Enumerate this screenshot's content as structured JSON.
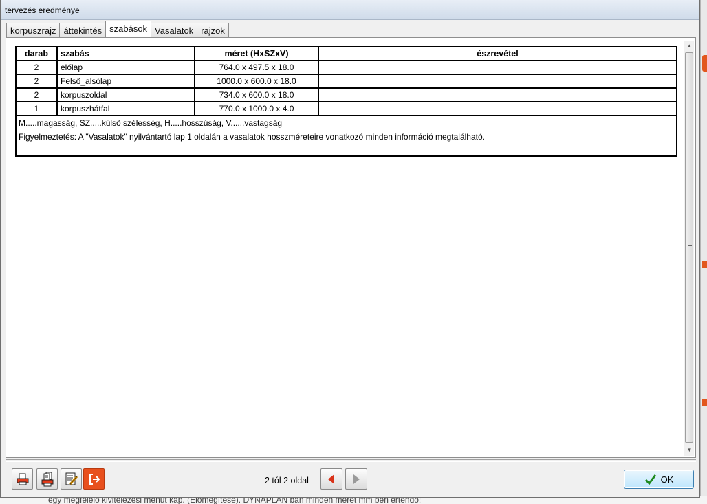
{
  "window": {
    "title": "tervezés eredménye"
  },
  "tabs": [
    {
      "label": "korpuszrajz",
      "active": false
    },
    {
      "label": "áttekintés",
      "active": false
    },
    {
      "label": "szabások",
      "active": true
    },
    {
      "label": "Vasalatok",
      "active": false
    },
    {
      "label": "rajzok",
      "active": false
    }
  ],
  "table": {
    "headers": {
      "qty": "darab",
      "name": "szabás",
      "size": "méret (HxSZxV)",
      "note": "észrevétel"
    },
    "rows": [
      {
        "qty": "2",
        "name": "előlap",
        "size": "764.0 x 497.5 x 18.0",
        "note": ""
      },
      {
        "qty": "2",
        "name": "Felső_alsólap",
        "size": "1000.0 x 600.0 x 18.0",
        "note": ""
      },
      {
        "qty": "2",
        "name": "korpuszoldal",
        "size": "734.0 x 600.0 x 18.0",
        "note": ""
      },
      {
        "qty": "1",
        "name": "korpuszhátfal",
        "size": "770.0 x 1000.0 x 4.0",
        "note": ""
      }
    ]
  },
  "notes": {
    "legend": "M.....magasság, SZ.....külső szélesség, H.....hosszúság, V......vastagság",
    "warning": "Figyelmeztetés: A \"Vasalatok\" nyilvántartó lap 1 oldalán a vasalatok hosszméreteire vonatkozó minden információ megtalálható."
  },
  "toolbar": {
    "page_info": "2 tól 2 oldal",
    "ok_label": "OK",
    "icons": [
      "printer-icon",
      "print-all-icon",
      "edit-document-icon",
      "exit-icon",
      "arrow-left-icon",
      "arrow-right-icon",
      "checkmark-icon"
    ]
  },
  "background": {
    "bottom_text": "egy megfelelő kivitelezési menüt kap. (Előmegítése). DYNAPLAN ban minden méret mm ben értendő!"
  },
  "colors": {
    "accent_orange": "#e8501d",
    "nav_arrow_red": "#d9331a",
    "ok_check_green": "#1f8a1f"
  }
}
